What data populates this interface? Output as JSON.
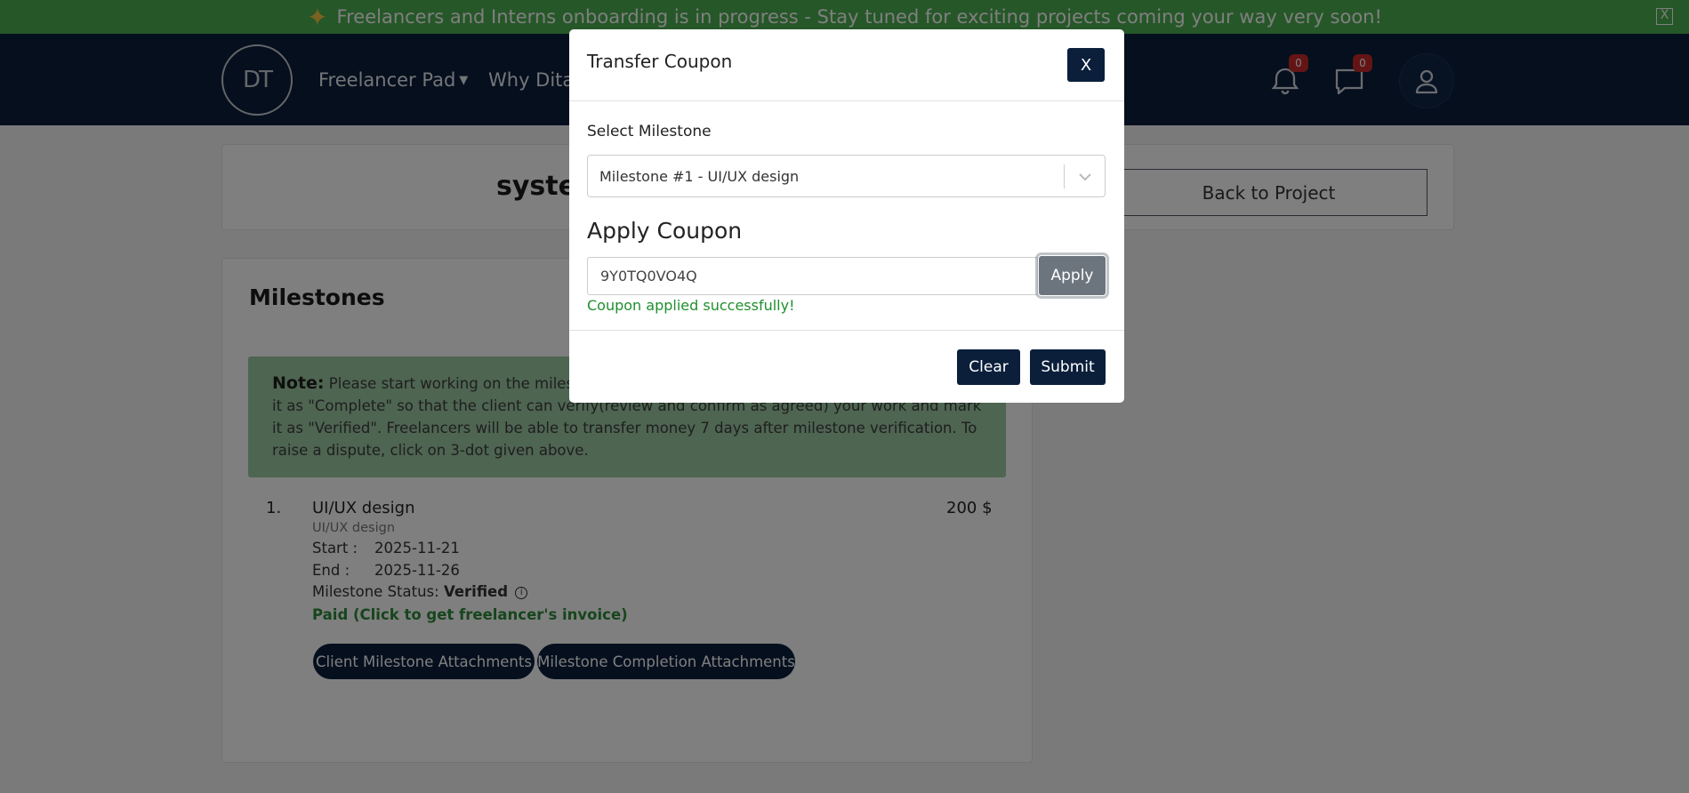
{
  "banner": {
    "icon": "sparkle-icon",
    "text": "Freelancers and Interns onboarding is in progress - Stay tuned for exciting projects coming your way very soon!",
    "close_label": "X"
  },
  "navbar": {
    "logo_text": "DT",
    "links": [
      {
        "label": "Freelancer Pad",
        "has_dropdown": true
      },
      {
        "label": "Why Ditar"
      }
    ],
    "notifications_count": "0",
    "messages_count": "0"
  },
  "project": {
    "title": "syster",
    "back_button": "Back to Project"
  },
  "milestones": {
    "heading": "Milestones",
    "note_label": "Note:",
    "note_text": "Please start working on the milestone",
    "note_text_rest": "it as \"Complete\" so that the client can verify(review and confirm as agreed) your work and mark it as \"Verified\". Freelancers will be able to transfer money 7 days after milestone verification. To raise a dispute, click on 3-dot given above.",
    "items": [
      {
        "number": "1.",
        "title": "UI/UX design",
        "subtitle": "UI/UX design",
        "amount": "200 $",
        "start_label": "Start   :",
        "start": "2025-11-21",
        "end_label": "End     :",
        "end": "2025-11-26",
        "status_label": "Milestone Status:",
        "status": "Verified",
        "paid_link": "Paid (Click to get freelancer's invoice)",
        "client_attachments": "Client Milestone Attachments",
        "completion_attachments": "Milestone Completion Attachments"
      }
    ]
  },
  "modal": {
    "title": "Transfer Coupon",
    "close_label": "X",
    "select_label": "Select Milestone",
    "select_value": "Milestone #1 - UI/UX design",
    "coupon_heading": "Apply Coupon",
    "coupon_value": "9Y0TQ0VO4Q",
    "apply_label": "Apply",
    "success_message": "Coupon applied successfully!",
    "clear_label": "Clear",
    "submit_label": "Submit"
  },
  "colors": {
    "navy": "#0b1f3b",
    "banner_green": "#4caf50",
    "note_green": "#9ccaa3",
    "success_green": "#1f8f2e",
    "badge_red": "#c62828"
  }
}
